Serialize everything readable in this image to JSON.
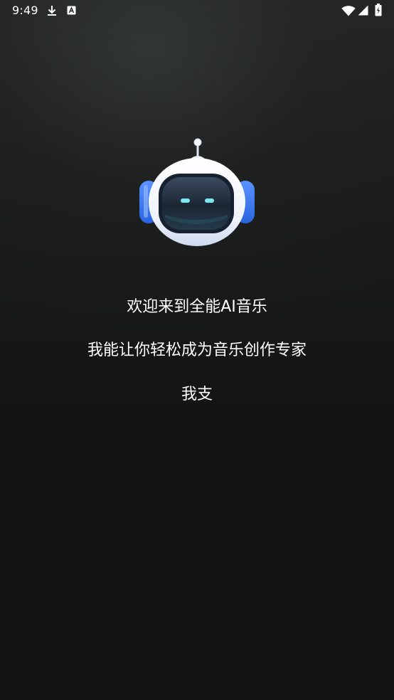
{
  "status_bar": {
    "time": "9:49",
    "icons": [
      "download-icon",
      "a-letter-icon",
      "wifi-icon",
      "signal-icon",
      "battery-icon"
    ]
  },
  "welcome": {
    "line1": "欢迎来到全能AI音乐",
    "line2": "我能让你轻松成为音乐创作专家",
    "line3": "我支"
  },
  "colors": {
    "background": "#131313",
    "text": "#ffffff",
    "robot_accent": "#3d7bf0",
    "robot_eyes": "#7ee8f2"
  }
}
